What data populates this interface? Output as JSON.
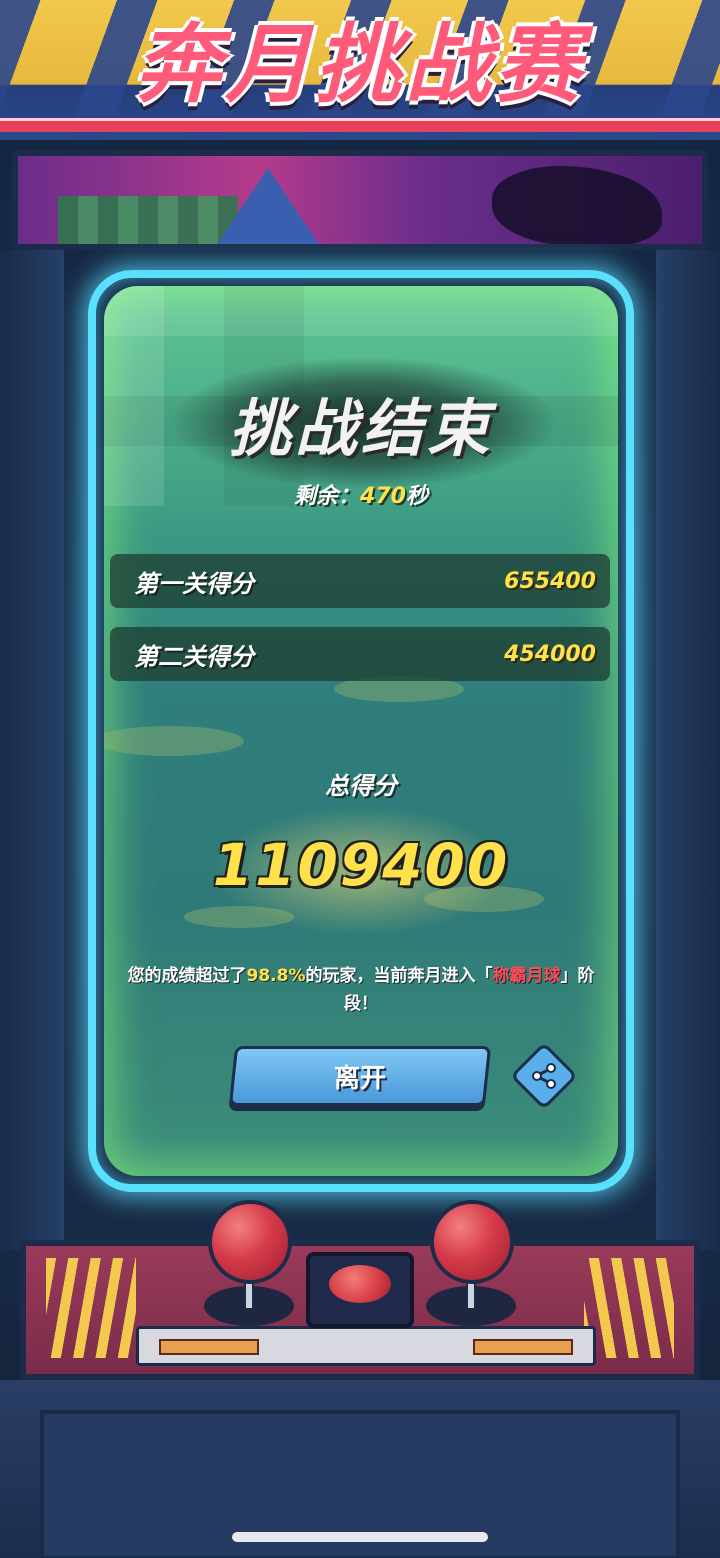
{
  "banner": {
    "title": "奔月挑战赛"
  },
  "result": {
    "title": "挑战结束",
    "remaining_label": "剩余：",
    "remaining_value": "470",
    "remaining_unit": "秒",
    "rows": [
      {
        "label": "第一关得分",
        "value": "655400"
      },
      {
        "label": "第二关得分",
        "value": "454000"
      }
    ],
    "total_label": "总得分",
    "total_value": "1109400",
    "rank": {
      "prefix": "您的成绩超过了",
      "percent": "98.8%",
      "middle": "的玩家，当前奔月进入「",
      "stage": "称霸月球",
      "suffix": "」阶段！"
    }
  },
  "actions": {
    "leave_label": "离开",
    "share_icon": "share-icon"
  },
  "colors": {
    "accent_yellow": "#ffe14a",
    "accent_red": "#ff4a5a",
    "glow_cyan": "#59e0ff",
    "button_blue": "#4a98d8"
  }
}
